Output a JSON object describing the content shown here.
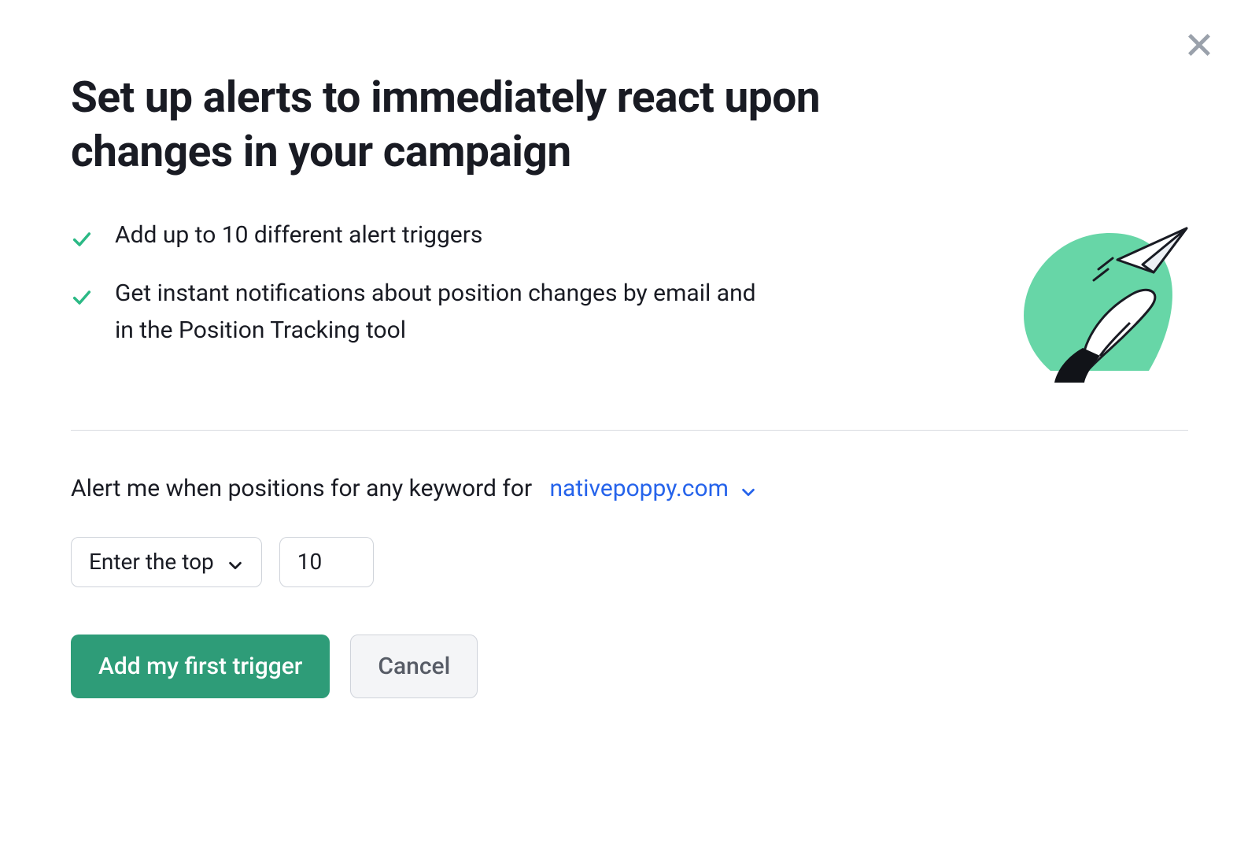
{
  "heading": "Set up alerts to immediately react upon changes in your campaign",
  "benefits": [
    "Add up to 10 different alert triggers",
    "Get instant notifications about position changes by email and in the Position Tracking tool"
  ],
  "condition": {
    "prefix": "Alert me when positions for any keyword for",
    "domain": "nativepoppy.com"
  },
  "select": {
    "label": "Enter the top"
  },
  "threshold_value": "10",
  "buttons": {
    "primary": "Add my first trigger",
    "cancel": "Cancel"
  },
  "colors": {
    "accent_green": "#2e9c78",
    "check_green": "#2bb985",
    "link_blue": "#2563eb"
  }
}
